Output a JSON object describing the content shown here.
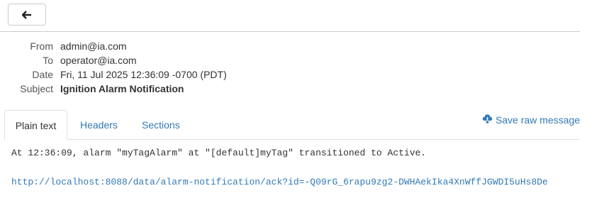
{
  "toolbar": {
    "back_icon": "arrow-left-icon"
  },
  "headers": {
    "from_label": "From",
    "from_value": "admin@ia.com",
    "to_label": "To",
    "to_value": "operator@ia.com",
    "date_label": "Date",
    "date_value": "Fri, 11 Jul 2025 12:36:09 -0700 (PDT)",
    "subject_label": "Subject",
    "subject_value": "Ignition Alarm Notification"
  },
  "tabs": [
    {
      "label": "Plain text",
      "active": true
    },
    {
      "label": "Headers",
      "active": false
    },
    {
      "label": "Sections",
      "active": false
    }
  ],
  "save_raw": {
    "label": "Save raw message",
    "icon": "cloud-download-icon"
  },
  "message": {
    "line1": "At 12:36:09, alarm \"myTagAlarm\" at \"[default]myTag\" transitioned to Active.",
    "link": "http://localhost:8088/data/alarm-notification/ack?id=-Q09rG_6rapu9zg2-DWHAekIka4XnWffJGWDI5uHs8De"
  },
  "colors": {
    "link": "#337ab7",
    "border": "#cccccc",
    "text": "#333333"
  }
}
